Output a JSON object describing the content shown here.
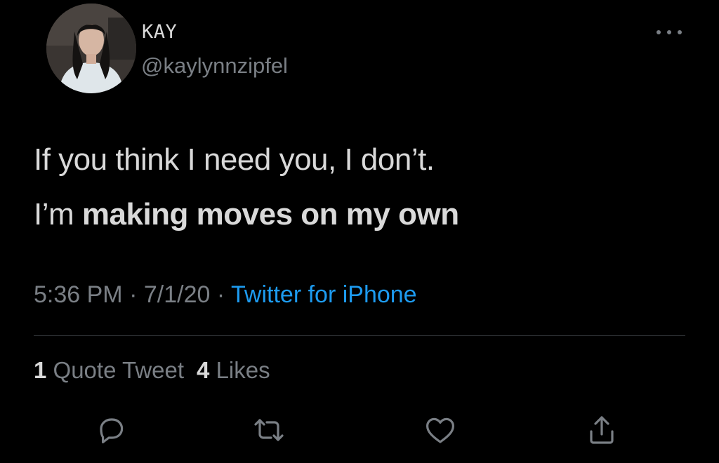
{
  "user": {
    "display_name": "KAY",
    "handle": "@kaylynnzipfel",
    "avatar_icon": "profile-photo"
  },
  "tweet": {
    "line1": "If you think I need you, I don’t.",
    "line2_prefix": "I’m ",
    "line2_bold": "making moves on my own",
    "time": "5:36 PM",
    "date": "7/1/20",
    "separator": "·",
    "source": "Twitter for iPhone"
  },
  "stats": {
    "quote_count": "1",
    "quote_label": "Quote Tweet",
    "like_count": "4",
    "like_label": "Likes"
  },
  "actions": {
    "reply_icon": "reply-icon",
    "retweet_icon": "retweet-icon",
    "like_icon": "heart-icon",
    "share_icon": "share-icon"
  },
  "colors": {
    "background": "#000000",
    "text": "#d9d9d9",
    "muted": "#7a7f85",
    "link": "#1d9bf0",
    "divider": "#2f3336"
  }
}
